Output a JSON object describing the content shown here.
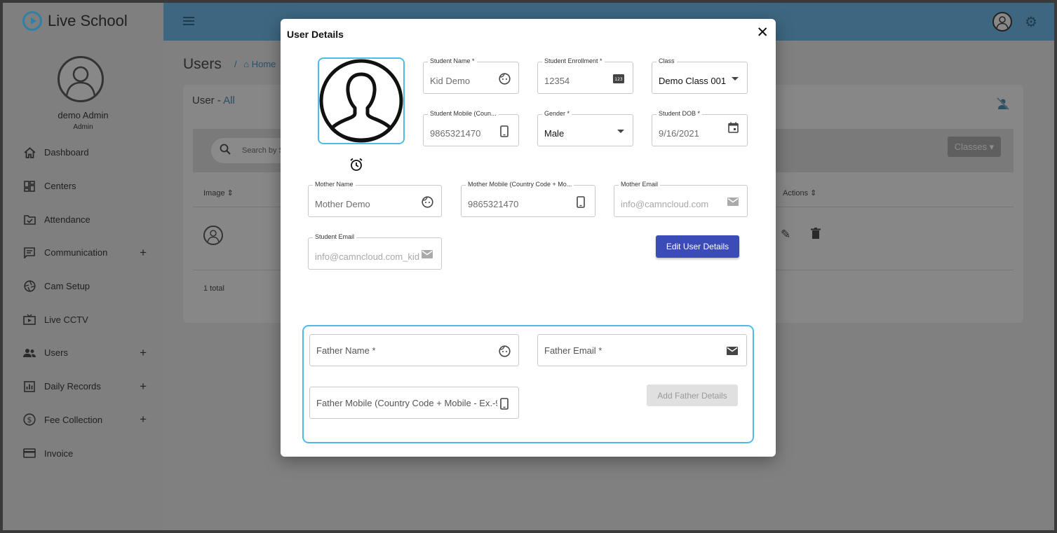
{
  "app": {
    "title": "Live School"
  },
  "profile": {
    "name": "demo Admin",
    "role": "Admin"
  },
  "sidebar": {
    "items": [
      {
        "label": "Dashboard",
        "icon": "home-icon",
        "expandable": false
      },
      {
        "label": "Centers",
        "icon": "dashboard-grid-icon",
        "expandable": false
      },
      {
        "label": "Attendance",
        "icon": "attendance-icon",
        "expandable": false
      },
      {
        "label": "Communication",
        "icon": "chat-icon",
        "expandable": true
      },
      {
        "label": "Cam Setup",
        "icon": "camera-aperture-icon",
        "expandable": false
      },
      {
        "label": "Live CCTV",
        "icon": "tv-icon",
        "expandable": false
      },
      {
        "label": "Users",
        "icon": "users-icon",
        "expandable": true
      },
      {
        "label": "Daily Records",
        "icon": "bar-chart-icon",
        "expandable": true
      },
      {
        "label": "Fee Collection",
        "icon": "dollar-icon",
        "expandable": true
      },
      {
        "label": "Invoice",
        "icon": "credit-card-icon",
        "expandable": false
      }
    ],
    "plus_symbol": "+"
  },
  "page": {
    "title": "Users",
    "breadcrumb_sep": "/",
    "breadcrumb_home": "Home",
    "card_title_prefix": "User - ",
    "card_title_filter": "All",
    "search_placeholder": "Search by S",
    "classes_button": "Classes",
    "columns": {
      "image": "Image",
      "actions": "Actions"
    },
    "total": "1 total"
  },
  "modal": {
    "title": "User Details",
    "student_name": {
      "label": "Student Name *",
      "value": "Kid Demo"
    },
    "student_enrollment": {
      "label": "Student Enrollment *",
      "value": "12354"
    },
    "class": {
      "label": "Class",
      "value": "Demo Class 001"
    },
    "student_mobile": {
      "label": "Student Mobile (Coun...",
      "value": "9865321470"
    },
    "gender": {
      "label": "Gender *",
      "value": "Male"
    },
    "student_dob": {
      "label": "Student DOB *",
      "value": "9/16/2021"
    },
    "mother_name": {
      "label": "Mother Name",
      "value": "Mother Demo"
    },
    "mother_mobile": {
      "label": "Mother Mobile (Country Code + Mo...",
      "value": "9865321470"
    },
    "mother_email": {
      "label": "Mother Email",
      "placeholder": "info@camncloud.com"
    },
    "student_email": {
      "label": "Student Email",
      "placeholder": "info@camncloud.com_kid"
    },
    "edit_button": "Edit User Details",
    "father_name": {
      "placeholder": "Father Name *"
    },
    "father_email": {
      "placeholder": "Father Email *"
    },
    "father_mobile": {
      "placeholder": "Father Mobile (Country Code + Mobile - Ex.-9..."
    },
    "add_father_button": "Add Father Details"
  },
  "colors": {
    "accent_blue": "#3b4cb8",
    "highlight_border": "#4fbce6",
    "header_blue": "#3d6781"
  }
}
